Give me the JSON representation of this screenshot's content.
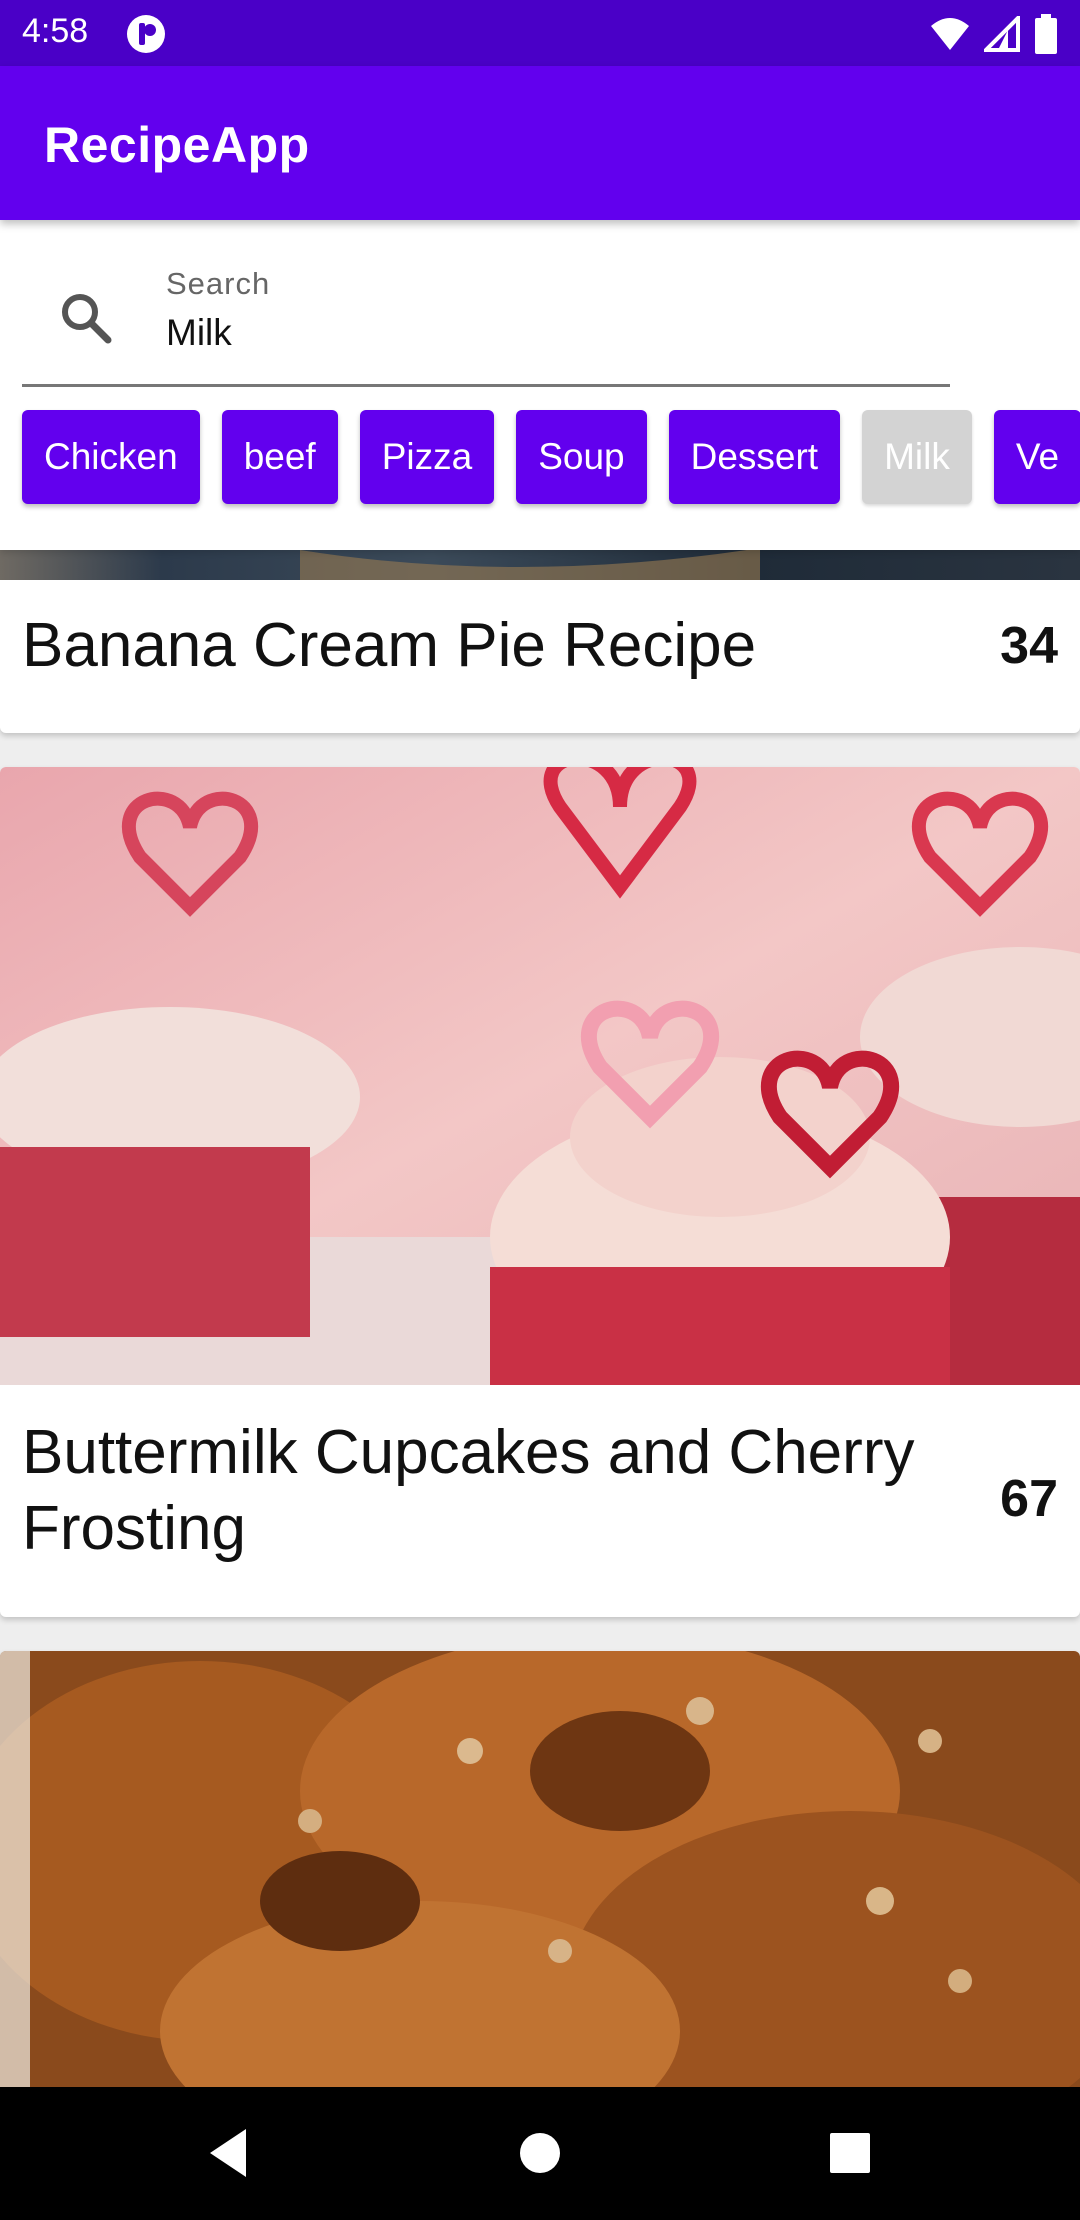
{
  "status_bar": {
    "time": "4:58"
  },
  "app_bar": {
    "title": "RecipeApp"
  },
  "search": {
    "label": "Search",
    "value": "Milk"
  },
  "chips": [
    {
      "label": "Chicken",
      "selected": false
    },
    {
      "label": "beef",
      "selected": false
    },
    {
      "label": "Pizza",
      "selected": false
    },
    {
      "label": "Soup",
      "selected": false
    },
    {
      "label": "Dessert",
      "selected": false
    },
    {
      "label": "Milk",
      "selected": true
    },
    {
      "label": "Ve",
      "selected": false
    }
  ],
  "recipes": [
    {
      "title": "Banana Cream Pie Recipe",
      "rating": "34"
    },
    {
      "title": "Buttermilk Cupcakes and Cherry Frosting",
      "rating": "67"
    }
  ],
  "colors": {
    "primary": "#6200ee",
    "primary_dark": "#4a00c7",
    "chip_selected": "#d3d3d3"
  },
  "icons": [
    "signal-icon",
    "wifi-icon",
    "battery-icon",
    "search-icon",
    "back-icon",
    "home-icon",
    "recents-icon"
  ]
}
